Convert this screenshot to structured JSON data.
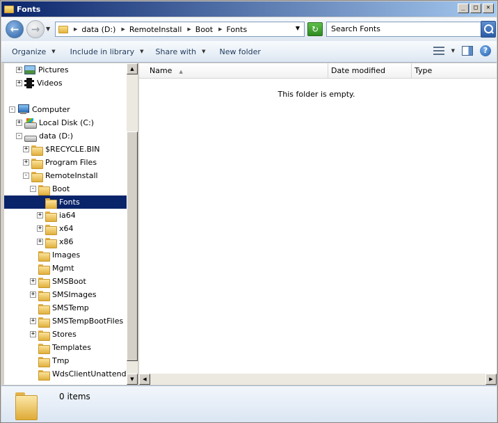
{
  "window": {
    "title": "Fonts",
    "controls": {
      "minimize": "_",
      "maximize": "□",
      "close": "✕"
    }
  },
  "address": {
    "breadcrumbs": [
      "data (D:)",
      "RemoteInstall",
      "Boot",
      "Fonts"
    ],
    "search_placeholder": "Search Fonts"
  },
  "toolbar": {
    "organize": "Organize",
    "include_in_library": "Include in library",
    "share_with": "Share with",
    "new_folder": "New folder"
  },
  "tree": {
    "pictures": "Pictures",
    "videos": "Videos",
    "computer": "Computer",
    "local_disk": "Local Disk (C:)",
    "data_drive": "data (D:)",
    "recycle_bin": "$RECYCLE.BIN",
    "program_files": "Program Files",
    "remote_install": "RemoteInstall",
    "boot": "Boot",
    "fonts": "Fonts",
    "ia64": "ia64",
    "x64": "x64",
    "x86": "x86",
    "images": "Images",
    "mgmt": "Mgmt",
    "smsboot": "SMSBoot",
    "smsimages": "SMSImages",
    "smstemp": "SMSTemp",
    "smstempbootfiles": "SMSTempBootFiles",
    "stores": "Stores",
    "templates": "Templates",
    "tmp": "Tmp",
    "wdsclientunattend": "WdsClientUnattend"
  },
  "columns": {
    "name": "Name",
    "date_modified": "Date modified",
    "type": "Type"
  },
  "content": {
    "empty_message": "This folder is empty."
  },
  "details": {
    "count": "0 items"
  }
}
